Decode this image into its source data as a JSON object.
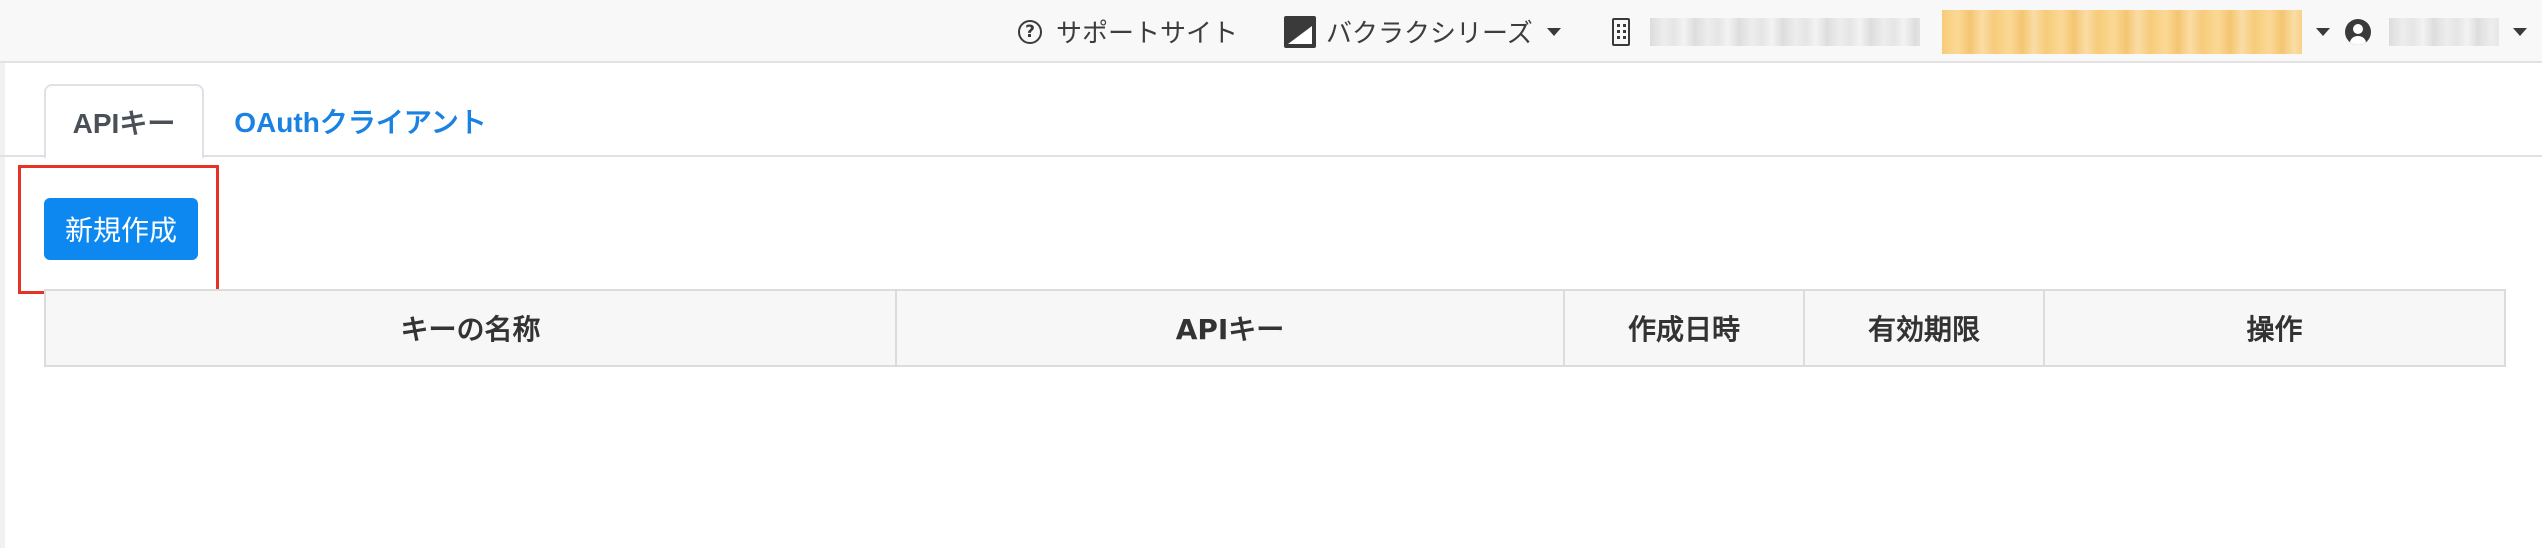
{
  "topbar": {
    "support_label": "サポートサイト",
    "support_icon": "help-circle-icon",
    "series_label": "バクラクシリーズ",
    "series_icon": "bakuraku-logo-icon",
    "org_icon": "building-icon",
    "user_icon": "user-circle-icon"
  },
  "tabs": [
    {
      "label": "APIキー",
      "active": true
    },
    {
      "label": "OAuthクライアント",
      "active": false
    }
  ],
  "toolbar": {
    "new_button_label": "新規作成",
    "highlight_color": "#e53325",
    "button_color": "#0d88f0"
  },
  "table": {
    "columns": [
      "キーの名称",
      "APIキー",
      "作成日時",
      "有効期限",
      "操作"
    ],
    "rows": []
  }
}
